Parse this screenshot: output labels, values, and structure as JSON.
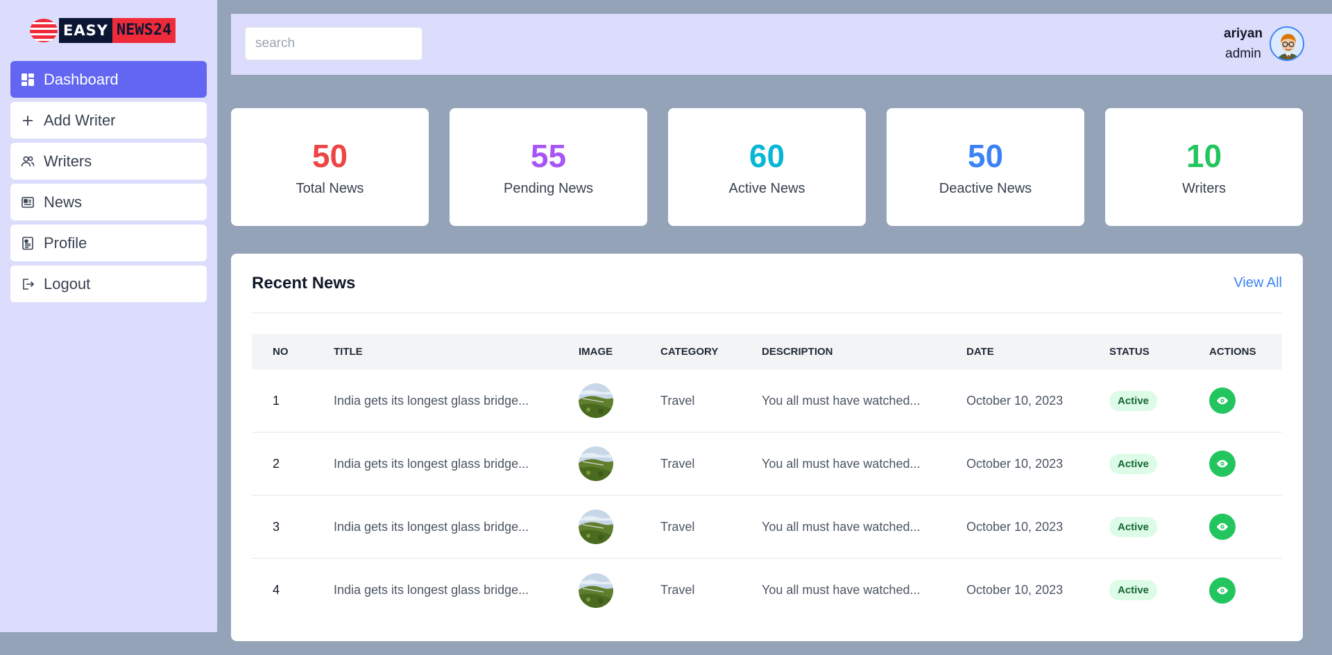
{
  "brand": {
    "part1": "EASY",
    "part2": "NEWS24"
  },
  "sidebar": {
    "items": [
      {
        "label": "Dashboard",
        "icon": "dashboard-icon",
        "active": true
      },
      {
        "label": "Add Writer",
        "icon": "plus-icon"
      },
      {
        "label": "Writers",
        "icon": "users-icon"
      },
      {
        "label": "News",
        "icon": "newspaper-icon"
      },
      {
        "label": "Profile",
        "icon": "profile-icon"
      },
      {
        "label": "Logout",
        "icon": "logout-icon"
      }
    ]
  },
  "header": {
    "search_placeholder": "search",
    "user_name": "ariyan",
    "user_role": "admin"
  },
  "stats": [
    {
      "value": "50",
      "label": "Total News",
      "color": "#ef4444"
    },
    {
      "value": "55",
      "label": "Pending News",
      "color": "#a855f7"
    },
    {
      "value": "60",
      "label": "Active News",
      "color": "#06b6d4"
    },
    {
      "value": "50",
      "label": "Deactive News",
      "color": "#3b82f6"
    },
    {
      "value": "10",
      "label": "Writers",
      "color": "#22c55e"
    }
  ],
  "recent": {
    "title": "Recent News",
    "view_all": "View All",
    "columns": [
      "NO",
      "TITLE",
      "IMAGE",
      "CATEGORY",
      "DESCRIPTION",
      "DATE",
      "STATUS",
      "ACTIONS"
    ],
    "rows": [
      {
        "no": "1",
        "title": "India gets its longest glass bridge...",
        "category": "Travel",
        "description": "You all must have watched...",
        "date": "October 10, 2023",
        "status": "Active"
      },
      {
        "no": "2",
        "title": "India gets its longest glass bridge...",
        "category": "Travel",
        "description": "You all must have watched...",
        "date": "October 10, 2023",
        "status": "Active"
      },
      {
        "no": "3",
        "title": "India gets its longest glass bridge...",
        "category": "Travel",
        "description": "You all must have watched...",
        "date": "October 10, 2023",
        "status": "Active"
      },
      {
        "no": "4",
        "title": "India gets its longest glass bridge...",
        "category": "Travel",
        "description": "You all must have watched...",
        "date": "October 10, 2023",
        "status": "Active"
      }
    ]
  },
  "colors": {
    "accent": "#6366f1",
    "panel": "#dcdcfc",
    "background": "#94a3b8",
    "success": "#22c55e"
  }
}
